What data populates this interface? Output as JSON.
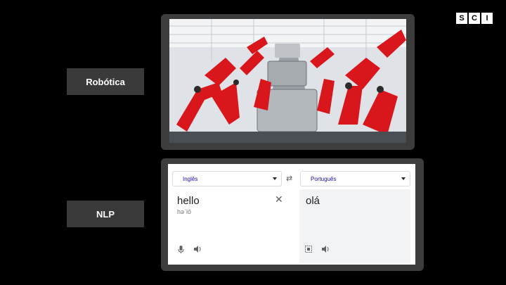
{
  "logo": {
    "letters": [
      "S",
      "C",
      "I"
    ]
  },
  "labels": {
    "robotics": "Robótica",
    "nlp": "NLP"
  },
  "translator": {
    "source_language": "Inglês",
    "target_language": "Português",
    "source_text": "hello",
    "phonetic": "həˈlō",
    "translated_text": "olá"
  },
  "icons": {
    "clear": "close-icon",
    "swap": "swap-icon",
    "mic": "microphone-icon",
    "speaker": "speaker-icon",
    "select": "select-text-icon"
  },
  "colors": {
    "background": "#000000",
    "label_bg": "#3a3a3a",
    "frame": "#3d3d3d",
    "robot_red": "#d8161b"
  }
}
